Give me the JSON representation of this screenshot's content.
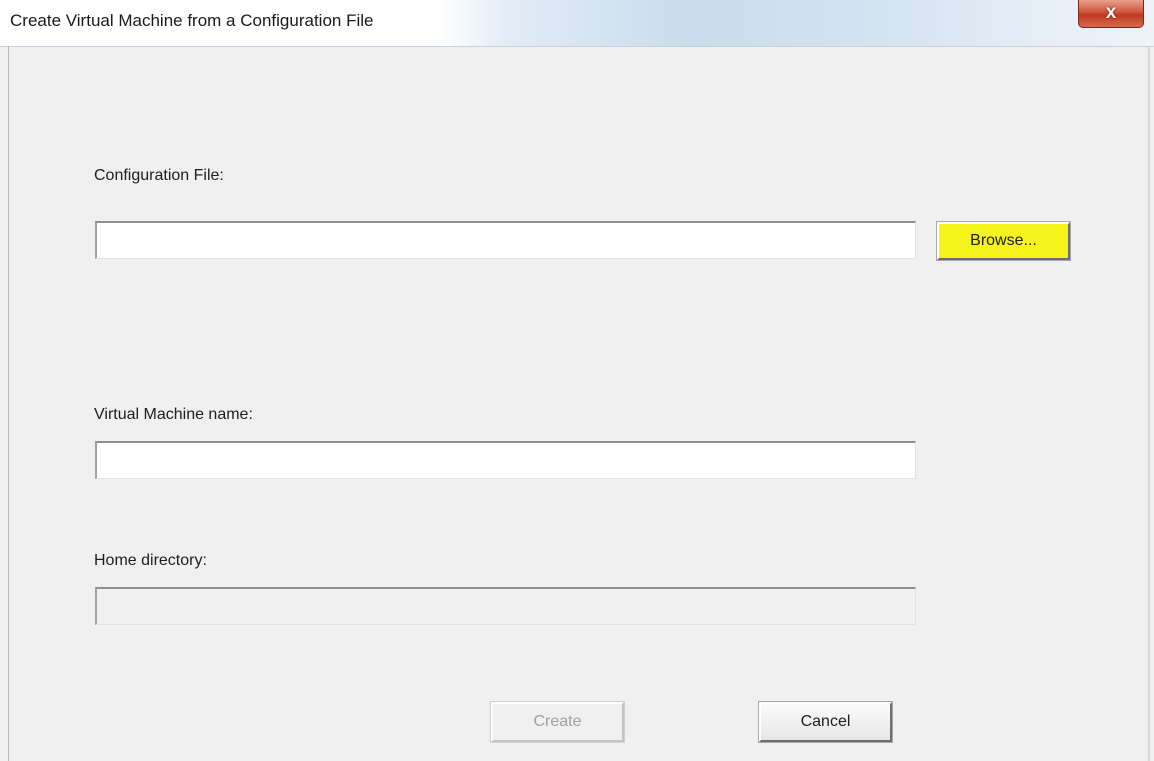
{
  "window": {
    "title": "Create Virtual Machine from a Configuration File",
    "close_glyph": "x"
  },
  "config_file": {
    "label": "Configuration File:",
    "value": "",
    "browse_label": "Browse..."
  },
  "vm_name": {
    "label": "Virtual Machine name:",
    "value": ""
  },
  "home_directory": {
    "label": "Home directory:",
    "value": ""
  },
  "buttons": {
    "create_label": "Create",
    "cancel_label": "Cancel"
  },
  "colors": {
    "browse_highlight": "#f4f31a",
    "dialog_background": "#f0f0f0",
    "close_button": "#c0391f"
  },
  "icons": {
    "close": "close-icon"
  }
}
